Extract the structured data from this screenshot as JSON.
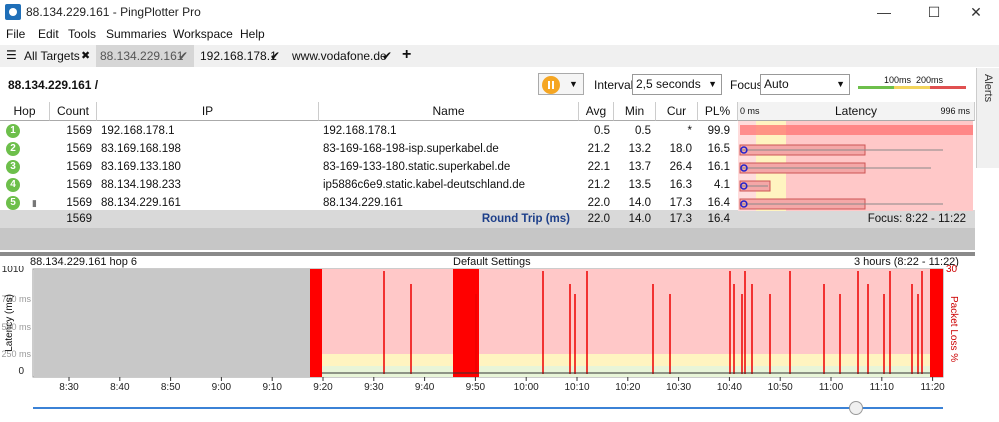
{
  "window": {
    "title": "88.134.229.161 - PingPlotter Pro",
    "minimize": "—",
    "maximize": "☐",
    "close": "✕"
  },
  "menu": [
    "File",
    "Edit",
    "Tools",
    "Summaries",
    "Workspace",
    "Help"
  ],
  "tabs": [
    {
      "label": "All Targets",
      "mark": "✖"
    },
    {
      "label": "88.134.229.161",
      "mark": "✔"
    },
    {
      "label": "192.168.178.1",
      "mark": "✔"
    },
    {
      "label": "www.vodafone.de",
      "mark": "✔"
    }
  ],
  "add_tab": "+",
  "header": {
    "target": "88.134.229.161 /",
    "interval_label": "Interval",
    "interval_value": "2,5 seconds",
    "focus_label": "Focus",
    "focus_value": "Auto",
    "scale_100": "100ms",
    "scale_200": "200ms"
  },
  "alerts": "Alerts",
  "table": {
    "columns": [
      "Hop",
      "Count",
      "IP",
      "Name",
      "Avg",
      "Min",
      "Cur",
      "PL%",
      "Latency"
    ],
    "lat_min": "0 ms",
    "lat_max": "996 ms",
    "rows": [
      {
        "hop": "1",
        "count": "1569",
        "ip": "192.168.178.1",
        "name": "192.168.178.1",
        "avg": "0.5",
        "min": "0.5",
        "cur": "*",
        "pl": "99.9"
      },
      {
        "hop": "2",
        "count": "1569",
        "ip": "83.169.168.198",
        "name": "83-169-168-198-isp.superkabel.de",
        "avg": "21.2",
        "min": "13.2",
        "cur": "18.0",
        "pl": "16.5"
      },
      {
        "hop": "3",
        "count": "1569",
        "ip": "83.169.133.180",
        "name": "83-169-133-180.static.superkabel.de",
        "avg": "22.1",
        "min": "13.7",
        "cur": "26.4",
        "pl": "16.1"
      },
      {
        "hop": "4",
        "count": "1569",
        "ip": "88.134.198.233",
        "name": "ip5886c6e9.static.kabel-deutschland.de",
        "avg": "21.2",
        "min": "13.5",
        "cur": "16.3",
        "pl": "4.1"
      },
      {
        "hop": "5",
        "count": "1569",
        "ip": "88.134.229.161",
        "name": "88.134.229.161",
        "avg": "22.0",
        "min": "14.0",
        "cur": "17.3",
        "pl": "16.4"
      }
    ],
    "summary": {
      "count": "1569",
      "label": "Round Trip (ms)",
      "avg": "22.0",
      "min": "14.0",
      "cur": "17.3",
      "pl": "16.4",
      "focus": "Focus: 8:22 - 11:22"
    }
  },
  "timegraph": {
    "left_title": "88.134.229.161 hop 6",
    "center_title": "Default Settings",
    "right_title": "3 hours (8:22 - 11:22)",
    "y_label": "Latency (ms)",
    "y2_label": "Packet Loss %",
    "y_ticks": [
      "1010",
      "750 ms",
      "500 ms",
      "250 ms",
      "0"
    ],
    "y2_top": "30",
    "x_ticks": [
      "8:30",
      "8:40",
      "8:50",
      "9:00",
      "9:10",
      "9:20",
      "9:30",
      "9:40",
      "9:50",
      "10:00",
      "10:10",
      "10:20",
      "10:30",
      "10:40",
      "10:50",
      "11:00",
      "11:10",
      "11:20"
    ]
  },
  "colors": {
    "loss_red": "#ff0000",
    "loss_bg": "#ffc8c8",
    "warn_yellow": "#fff4c0",
    "ok_green": "#6dbf4b",
    "accent_blue": "#3b82d6"
  }
}
